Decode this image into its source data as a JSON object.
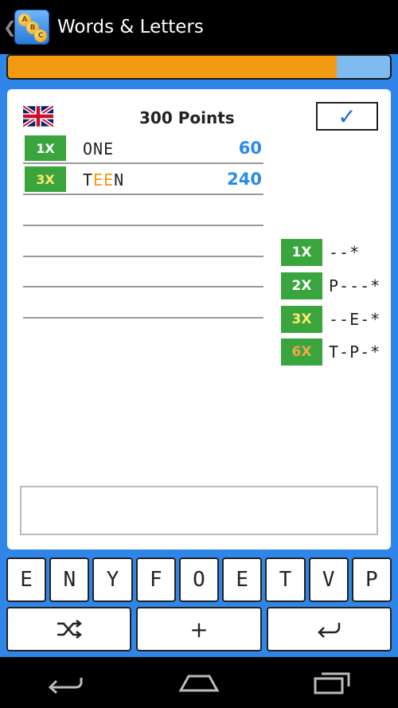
{
  "app": {
    "title": "Words & Letters"
  },
  "progress": {
    "fraction": 0.86
  },
  "score": {
    "points": "300 Points",
    "flag": "uk-flag",
    "check_symbol": "✓"
  },
  "words": [
    {
      "multiplier": "1X",
      "word_parts": [
        "ONE"
      ],
      "score": "60"
    },
    {
      "multiplier": "3X",
      "word_parts": [
        "T",
        "EE",
        "N"
      ],
      "score": "240"
    }
  ],
  "bonuses": [
    {
      "multiplier": "1X",
      "pattern": "--*"
    },
    {
      "multiplier": "2X",
      "pattern": "P---*"
    },
    {
      "multiplier": "3X",
      "pattern": "--E-*"
    },
    {
      "multiplier": "6X",
      "pattern": "T-P-*"
    }
  ],
  "letters": [
    "E",
    "N",
    "Y",
    "F",
    "O",
    "E",
    "T",
    "V",
    "P"
  ],
  "controls": {
    "shuffle_icon": "shuffle-icon",
    "add_label": "+",
    "enter_icon": "enter-icon"
  },
  "colors": {
    "accent_blue": "#2f86e8",
    "progress_orange": "#f39a12",
    "badge_green": "#3aa53c",
    "score_blue": "#2a8ae8"
  }
}
